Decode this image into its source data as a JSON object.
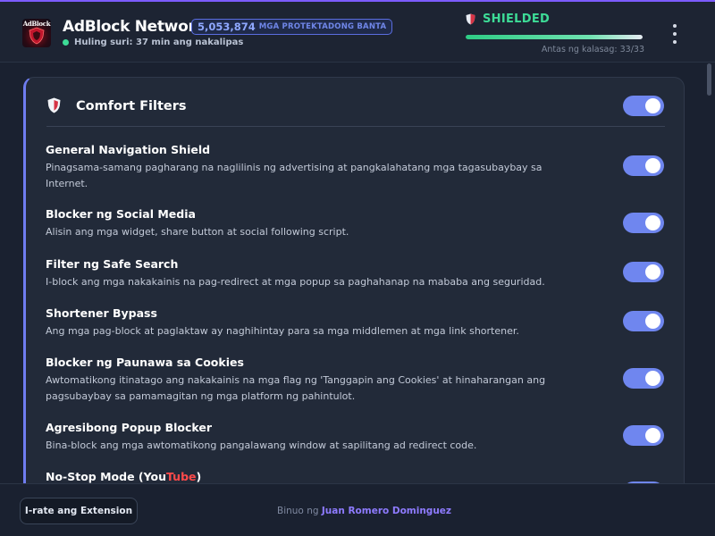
{
  "header": {
    "logo_text": "AdBlock",
    "app_title": "AdBlock Network",
    "badge_count": "5,053,874",
    "badge_label": "MGA PROTEKTADONG BANTA",
    "last_scan": "Huling suri: 37 min ang nakalipas",
    "status": "SHIELDED",
    "progress_percent": 100,
    "level_text": "Antas ng kalasag: 33/33",
    "colors": {
      "accent": "#6f86ef",
      "status_green": "#3ddc97",
      "brand_red": "#ff4a4a"
    }
  },
  "card": {
    "title": "Comfort Filters",
    "icon": "shield-icon",
    "master_toggle_on": true,
    "filters": [
      {
        "name": "General Navigation Shield",
        "desc": "Pinagsama-samang pagharang na naglilinis ng advertising at pangkalahatang mga tagasubaybay sa Internet.",
        "enabled": true
      },
      {
        "name": "Blocker ng Social Media",
        "desc": "Alisin ang mga widget, share button at social following script.",
        "enabled": true
      },
      {
        "name": "Filter ng Safe Search",
        "desc": "I-block ang mga nakakainis na pag-redirect at mga popup sa paghahanap na mababa ang seguridad.",
        "enabled": true
      },
      {
        "name": "Shortener Bypass",
        "desc": "Ang mga pag-block at paglaktaw ay naghihintay para sa mga middlemen at mga link shortener.",
        "enabled": true
      },
      {
        "name": "Blocker ng Paunawa sa Cookies",
        "desc": "Awtomatikong itinatago ang nakakainis na mga flag ng 'Tanggapin ang Cookies' at hinaharangan ang pagsubaybay sa pamamagitan ng mga platform ng pahintulot.",
        "enabled": true
      },
      {
        "name": "Agresibong Popup Blocker",
        "desc": "Bina-block ang mga awtomatikong pangalawang window at sapilitang ad redirect code.",
        "enabled": true
      },
      {
        "name_prefix": "No-Stop Mode (You",
        "name_red": "Tube",
        "name_suffix": ")",
        "enabled": true
      }
    ]
  },
  "footer": {
    "rate_label": "I-rate ang Extension",
    "credit_prefix": "Binuo ng",
    "credit_author": "Juan Romero Dominguez"
  }
}
